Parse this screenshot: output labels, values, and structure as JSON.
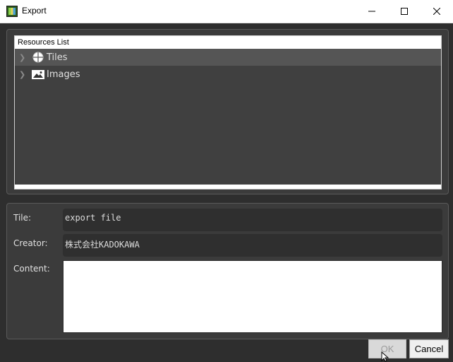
{
  "window": {
    "title": "Export",
    "icon": "app-icon",
    "controls": {
      "minimize": "minimize-icon",
      "maximize": "maximize-icon",
      "close": "close-icon"
    }
  },
  "resources": {
    "header": "Resources List",
    "items": [
      {
        "label": "Tiles",
        "icon": "tiles-icon",
        "selected": true
      },
      {
        "label": "Images",
        "icon": "image-icon",
        "selected": false
      }
    ]
  },
  "metadata": {
    "tile_label": "Tile:",
    "tile_value": "export file",
    "creator_label": "Creator:",
    "creator_value": "株式会社KADOKAWA",
    "content_label": "Content:",
    "content_value": ""
  },
  "buttons": {
    "ok_label": "OK",
    "cancel_label": "Cancel"
  },
  "colors": {
    "panel_bg": "#3b3b3b",
    "field_bg": "#2f2f2f",
    "selected_row": "#555555"
  }
}
